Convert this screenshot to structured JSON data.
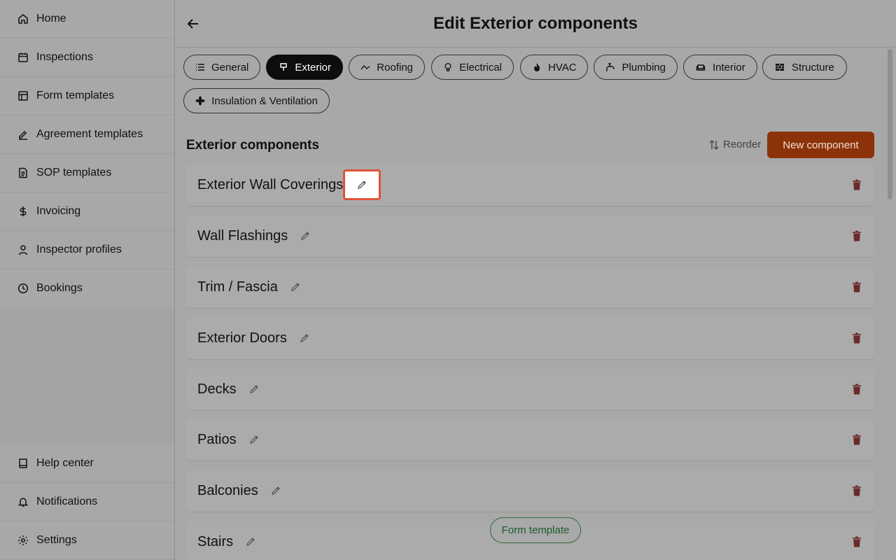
{
  "sidebar": {
    "items": [
      {
        "label": "Home",
        "icon": "home-icon"
      },
      {
        "label": "Inspections",
        "icon": "calendar-icon"
      },
      {
        "label": "Form templates",
        "icon": "layout-icon"
      },
      {
        "label": "Agreement templates",
        "icon": "signature-icon"
      },
      {
        "label": "SOP templates",
        "icon": "document-icon"
      },
      {
        "label": "Invoicing",
        "icon": "dollar-icon"
      },
      {
        "label": "Inspector profiles",
        "icon": "user-icon"
      },
      {
        "label": "Bookings",
        "icon": "clock-icon"
      }
    ],
    "bottom_items": [
      {
        "label": "Help center",
        "icon": "book-icon"
      },
      {
        "label": "Notifications",
        "icon": "bell-icon"
      },
      {
        "label": "Settings",
        "icon": "gear-icon"
      }
    ]
  },
  "header": {
    "title": "Edit Exterior components",
    "back_icon": "arrow-left-icon"
  },
  "tabs": [
    {
      "label": "General",
      "icon": "list-icon"
    },
    {
      "label": "Exterior",
      "icon": "paint-brush-icon",
      "active": true
    },
    {
      "label": "Roofing",
      "icon": "roof-icon"
    },
    {
      "label": "Electrical",
      "icon": "lightbulb-icon"
    },
    {
      "label": "HVAC",
      "icon": "flame-icon"
    },
    {
      "label": "Plumbing",
      "icon": "faucet-icon"
    },
    {
      "label": "Interior",
      "icon": "sofa-icon"
    },
    {
      "label": "Structure",
      "icon": "bricks-icon"
    },
    {
      "label": "Insulation & Ventilation",
      "icon": "fan-icon"
    }
  ],
  "section": {
    "title": "Exterior components",
    "reorder_label": "Reorder",
    "new_button_label": "New component"
  },
  "components": [
    {
      "name": "Exterior Wall Coverings",
      "edit_highlighted": true
    },
    {
      "name": "Wall Flashings"
    },
    {
      "name": "Trim / Fascia"
    },
    {
      "name": "Exterior Doors"
    },
    {
      "name": "Decks"
    },
    {
      "name": "Patios"
    },
    {
      "name": "Balconies"
    },
    {
      "name": "Stairs"
    }
  ],
  "floating_button": {
    "label": "Form template"
  },
  "colors": {
    "accent": "#8c3209",
    "highlight_border": "#e0523a",
    "delete_icon": "#6b2a2a",
    "floating_button": "#2e6b3e"
  }
}
